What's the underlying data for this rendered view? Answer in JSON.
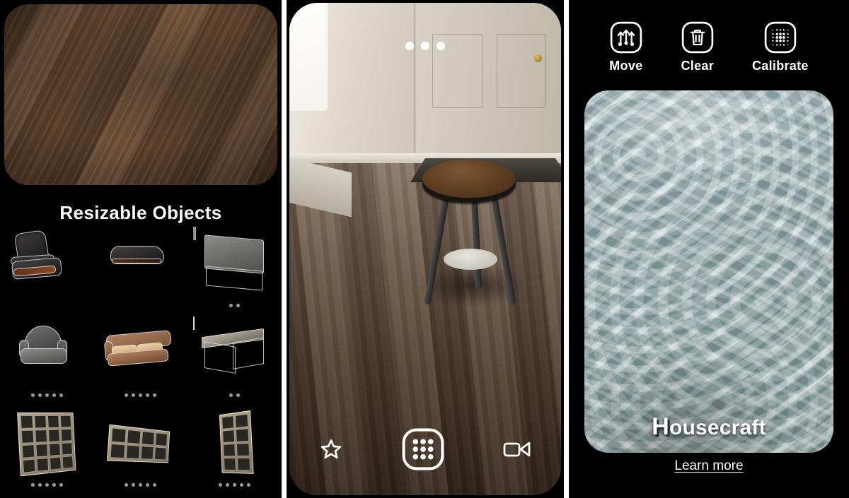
{
  "app": {
    "name": "Housecraft",
    "wordmark_initial": "H",
    "wordmark_rest": "ousecraft",
    "learn_more_label": "Learn more"
  },
  "panel_browser": {
    "camera_preview": {
      "icon": "wood-floor-camera-preview",
      "surface": "dark wood plank floor"
    },
    "section_title": "Resizable Objects",
    "rows": [
      {
        "items": [
          {
            "name": "lounge-chair",
            "label": "Lounge Chair",
            "dots": 0
          },
          {
            "name": "ottoman",
            "label": "Ottoman",
            "dots": 0
          },
          {
            "name": "nightstand",
            "label": "Nightstand",
            "dots": 2
          }
        ]
      },
      {
        "items": [
          {
            "name": "accent-armchair",
            "label": "Accent Armchair",
            "dots": 5
          },
          {
            "name": "sofa",
            "label": "Sofa",
            "dots": 5
          },
          {
            "name": "coffee-table",
            "label": "Coffee Table",
            "dots": 2
          }
        ]
      },
      {
        "items": [
          {
            "name": "shelving-unit-tall",
            "label": "Shelving Unit Tall",
            "dots": 5
          },
          {
            "name": "shelving-unit-wide",
            "label": "Shelving Unit Wide",
            "dots": 5
          },
          {
            "name": "shelving-unit-narrow",
            "label": "Shelving Unit Narrow",
            "dots": 5
          }
        ]
      }
    ]
  },
  "panel_ar": {
    "status_dots": 3,
    "scene": {
      "placed_object": "round-side-table",
      "surface": "dark wood plank floor",
      "background": "white interior door with brass knob"
    },
    "toolbar": [
      {
        "name": "favorite",
        "icon": "star-icon",
        "label": "Favorite"
      },
      {
        "name": "object-catalog",
        "icon": "grid-icon",
        "label": "Objects"
      },
      {
        "name": "record",
        "icon": "video-camera-icon",
        "label": "Record"
      }
    ]
  },
  "panel_tools": {
    "tools": [
      {
        "name": "move",
        "icon": "move-icon",
        "label": "Move"
      },
      {
        "name": "clear",
        "icon": "trash-icon",
        "label": "Clear"
      },
      {
        "name": "calibrate",
        "icon": "dot-grid-icon",
        "label": "Calibrate"
      }
    ],
    "texture_preview": {
      "icon": "water-texture-preview",
      "surface": "rippled water / stone texture"
    }
  },
  "colors": {
    "background": "#000000",
    "divider": "#ffffff",
    "text": "#ffffff",
    "dot": "#9a9a9a",
    "wood": "#6a4a31",
    "water": "#9eb2b2"
  }
}
